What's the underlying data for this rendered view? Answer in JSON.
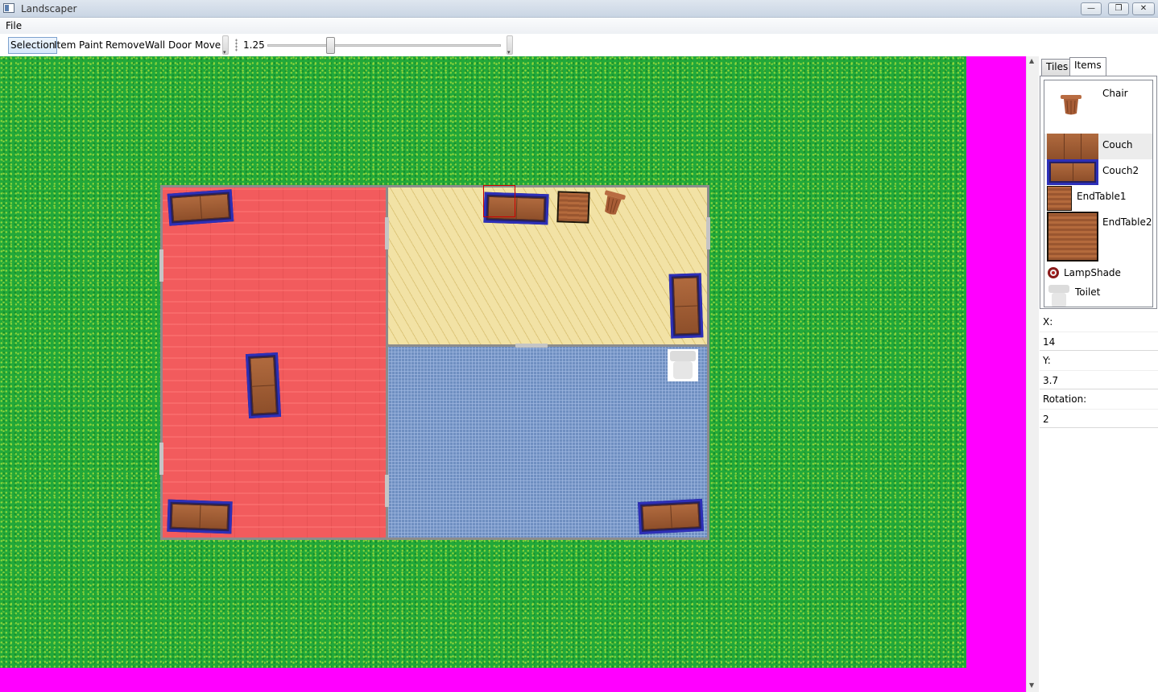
{
  "window": {
    "title": "Landscaper",
    "controls": {
      "minimize": "—",
      "maximize": "❐",
      "close": "✕"
    }
  },
  "menu": {
    "file": "File"
  },
  "toolbar": {
    "modes": [
      "Selection",
      "Item",
      "Paint",
      "Remove",
      "Wall",
      "Door",
      "Move"
    ],
    "active_mode": "Selection",
    "zoom_value": "1.25",
    "zoom_fraction": 0.26
  },
  "colors": {
    "grass": "#22a83a",
    "background": "#ff00ff",
    "red_floor": "#f25b5d",
    "sand_floor": "#f2e2a5",
    "blue_floor": "#6f8fc1",
    "wall": "#8c8c8c",
    "selection": "#cc0000"
  },
  "sidebar": {
    "tabs": [
      {
        "label": "Tiles",
        "active": false
      },
      {
        "label": "Items",
        "active": true
      }
    ],
    "items": [
      {
        "label": "Chair",
        "icon": "chair-icon",
        "selected": false
      },
      {
        "label": "Couch",
        "icon": "couch-icon",
        "selected": true
      },
      {
        "label": "Couch2",
        "icon": "couch2-icon",
        "selected": false
      },
      {
        "label": "EndTable1",
        "icon": "endtable1-icon",
        "selected": false
      },
      {
        "label": "EndTable2",
        "icon": "endtable2-icon",
        "selected": false
      },
      {
        "label": "LampShade",
        "icon": "lampshade-icon",
        "selected": false
      },
      {
        "label": "Toilet",
        "icon": "toilet-icon",
        "selected": false
      }
    ],
    "properties": {
      "x_label": "X:",
      "x_value": "14",
      "y_label": "Y:",
      "y_value": "3.7",
      "rotation_label": "Rotation:",
      "rotation_value": "2"
    }
  }
}
